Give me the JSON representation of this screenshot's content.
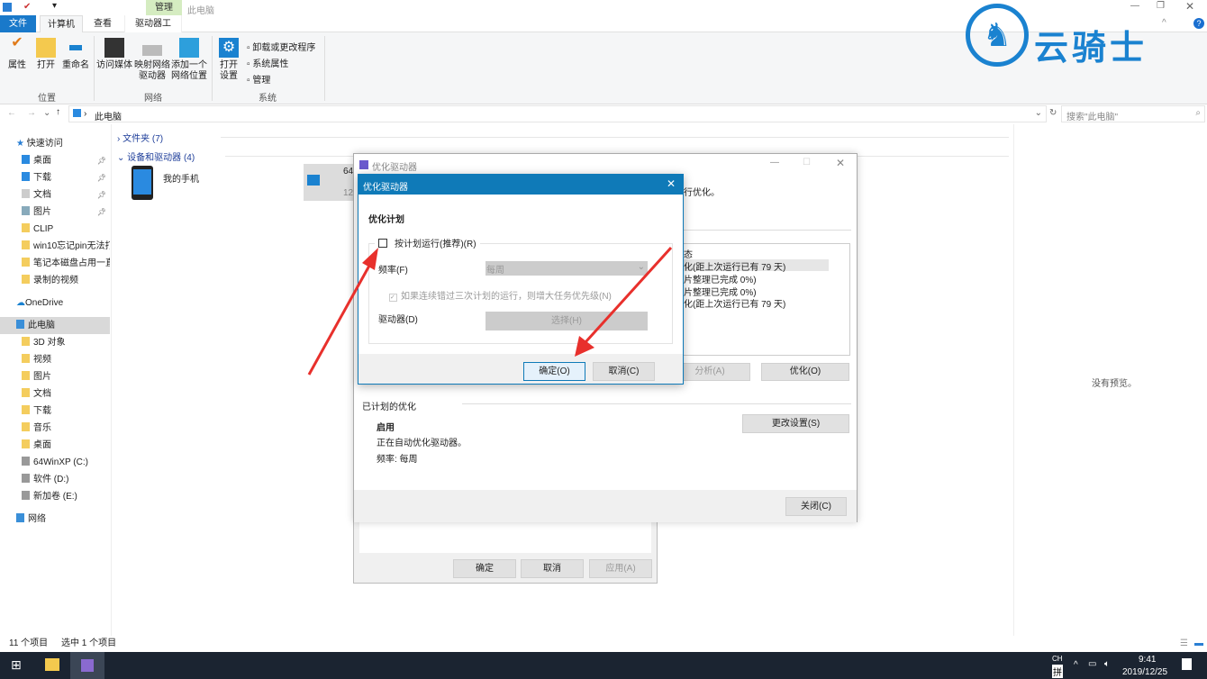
{
  "window": {
    "title": "此电脑",
    "context_tab": "管理"
  },
  "tabs": [
    "文件",
    "计算机",
    "查看",
    "驱动器工具"
  ],
  "ribbon": {
    "location": {
      "label": "位置",
      "items": [
        "属性",
        "打开",
        "重命名"
      ]
    },
    "network": {
      "label": "网络",
      "items": [
        "访问媒体",
        "映射网络驱动器",
        "添加一个网络位置"
      ]
    },
    "system": {
      "label": "系统",
      "open_settings": "打开设置",
      "items": [
        "卸载或更改程序",
        "系统属性",
        "管理"
      ]
    }
  },
  "address": {
    "path": "此电脑",
    "search_placeholder": "搜索\"此电脑\""
  },
  "sidebar": {
    "quick_access": "快速访问",
    "quick_items": [
      "桌面",
      "下载",
      "文档",
      "图片",
      "CLIP",
      "win10忘记pin无法打",
      "笔记本磁盘占用一直",
      "录制的视频"
    ],
    "onedrive": "OneDrive",
    "this_pc": "此电脑",
    "pc_items": [
      "3D 对象",
      "视频",
      "图片",
      "文档",
      "下载",
      "音乐",
      "桌面",
      "64WinXP  (C:)",
      "软件 (D:)",
      "新加卷 (E:)"
    ],
    "network": "网络"
  },
  "content": {
    "folders": "文件夹 (7)",
    "devices": "设备和驱动器 (4)",
    "phone": "我的手机",
    "drive_frag1": "64",
    "drive_frag2": "12",
    "no_preview": "没有预览。"
  },
  "optimize": {
    "title": "优化驱动器",
    "desc_frag": "行优化。",
    "status_header": "态",
    "rows": [
      "化(距上次运行已有 79 天)",
      "片整理已完成 0%)",
      "片整理已完成 0%)",
      "化(距上次运行已有 79 天)"
    ],
    "analyze": "分析(A)",
    "optimize": "优化(O)",
    "scheduled": "已计划的优化",
    "enabled": "启用",
    "auto": "正在自动优化驱动器。",
    "freq": "频率: 每周",
    "change": "更改设置(S)",
    "close": "关闭(C)"
  },
  "props": {
    "ok": "确定",
    "cancel": "取消",
    "apply": "应用(A)"
  },
  "schedule": {
    "title": "优化驱动器",
    "heading": "优化计划",
    "run_on_schedule": "按计划运行(推荐)(R)",
    "run_checked": false,
    "frequency_label": "频率(F)",
    "frequency_value": "每周",
    "increase_priority": "如果连续错过三次计划的运行，则增大任务优先级(N)",
    "drives_label": "驱动器(D)",
    "choose": "选择(H)",
    "ok": "确定(O)",
    "cancel": "取消(C)"
  },
  "statusbar": {
    "count": "11 个项目",
    "selected": "选中 1 个项目"
  },
  "watermark": "云骑士",
  "taskbar": {
    "ime_top": "CH",
    "ime": "拼",
    "time": "9:41",
    "date": "2019/12/25"
  },
  "colors": {
    "accent": "#0f7ab8",
    "arrow": "#e8302c",
    "watermark": "#1a82d0"
  }
}
